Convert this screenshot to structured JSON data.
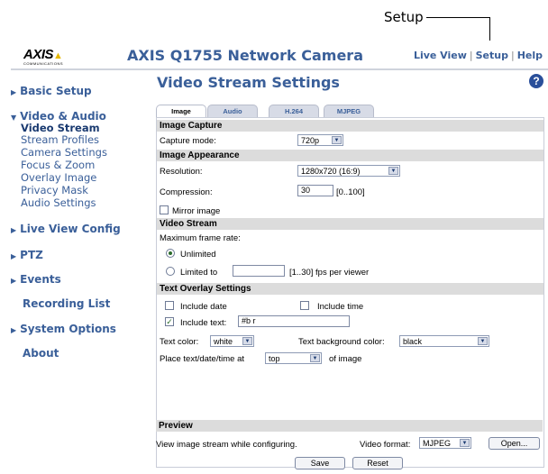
{
  "callout": {
    "label": "Setup"
  },
  "header": {
    "logo_text": "AXIS",
    "logo_sub": "COMMUNICATIONS",
    "camera_title": "AXIS Q1755 Network Camera",
    "links": [
      "Live View",
      "Setup",
      "Help"
    ]
  },
  "sidebar": {
    "basic_setup": "Basic Setup",
    "video_audio": "Video & Audio",
    "sub_items": [
      "Video Stream",
      "Stream Profiles",
      "Camera Settings",
      "Focus & Zoom",
      "Overlay Image",
      "Privacy Mask",
      "Audio Settings"
    ],
    "live_view_config": "Live View Config",
    "ptz": "PTZ",
    "events": "Events",
    "recording_list": "Recording List",
    "system_options": "System Options",
    "about": "About"
  },
  "main": {
    "page_title": "Video Stream Settings",
    "help_glyph": "?",
    "tabs": [
      "Image",
      "Audio",
      "H.264",
      "MJPEG"
    ],
    "image_capture": {
      "title": "Image Capture",
      "capture_mode_label": "Capture mode:",
      "capture_mode_value": "720p"
    },
    "image_appearance": {
      "title": "Image Appearance",
      "resolution_label": "Resolution:",
      "resolution_value": "1280x720 (16:9)",
      "compression_label": "Compression:",
      "compression_value": "30",
      "compression_range": "[0..100]",
      "mirror_label": "Mirror image"
    },
    "video_stream": {
      "title": "Video Stream",
      "max_frame_label": "Maximum frame rate:",
      "unlimited_label": "Unlimited",
      "limited_label": "Limited to",
      "limited_value": "",
      "fps_hint": "[1..30] fps per viewer"
    },
    "text_overlay": {
      "title": "Text Overlay Settings",
      "include_date": "Include date",
      "include_time": "Include time",
      "include_text": "Include text:",
      "include_text_value": "#b r",
      "text_color_label": "Text color:",
      "text_color_value": "white",
      "bg_color_label": "Text background color:",
      "bg_color_value": "black",
      "place_label": "Place text/date/time at",
      "place_value": "top",
      "of_image": "of image"
    },
    "preview": {
      "title": "Preview",
      "description": "View image stream while configuring.",
      "format_label": "Video format:",
      "format_value": "MJPEG",
      "open_button": "Open..."
    },
    "save_button": "Save",
    "reset_button": "Reset"
  }
}
